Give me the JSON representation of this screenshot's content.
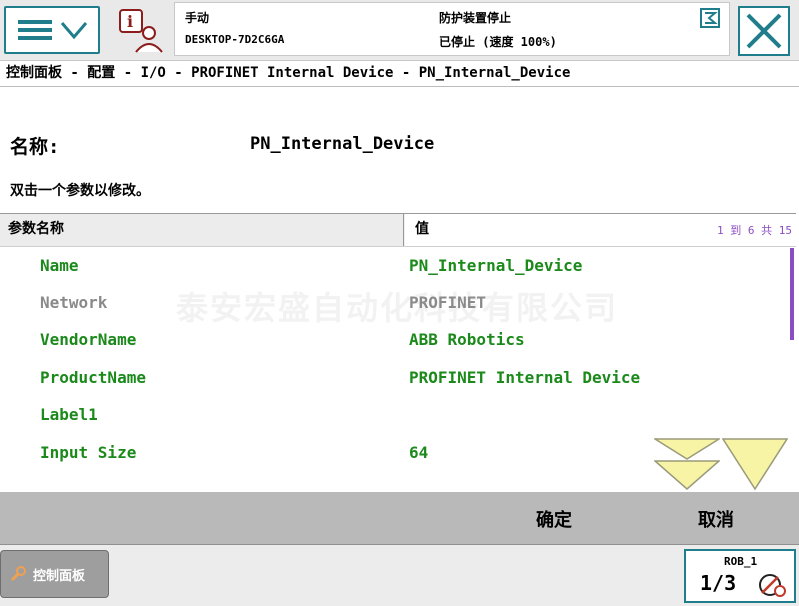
{
  "status": {
    "mode": "手动",
    "controller": "DESKTOP-7D2C6GA",
    "safety": "防护装置停止",
    "run_state": "已停止 (速度 100%)"
  },
  "breadcrumb": "控制面板 - 配置 - I/O - PROFINET Internal Device - PN_Internal_Device",
  "name_label": "名称:",
  "name_value": "PN_Internal_Device",
  "instruction": "双击一个参数以修改。",
  "table": {
    "col_name": "参数名称",
    "col_value": "值",
    "pager": "1 到 6 共 15",
    "rows": [
      {
        "name": "Name",
        "value": "PN_Internal_Device"
      },
      {
        "name": "Network",
        "value": "PROFINET"
      },
      {
        "name": "VendorName",
        "value": "ABB Robotics"
      },
      {
        "name": "ProductName",
        "value": "PROFINET Internal Device"
      },
      {
        "name": "Label1",
        "value": ""
      },
      {
        "name": "Input Size",
        "value": "64"
      }
    ]
  },
  "watermark": "泰安宏盛自动化科技有限公司",
  "actions": {
    "ok": "确定",
    "cancel": "取消"
  },
  "taskbar": {
    "control_panel": "控制面板"
  },
  "quickset": {
    "robot": "ROB_1",
    "ratio": "1/3"
  },
  "colors": {
    "accent": "#1f7d8c",
    "green": "#1b8a1b",
    "purple": "#8a4ec2",
    "arrow_yellow": "#f7f4a6"
  }
}
